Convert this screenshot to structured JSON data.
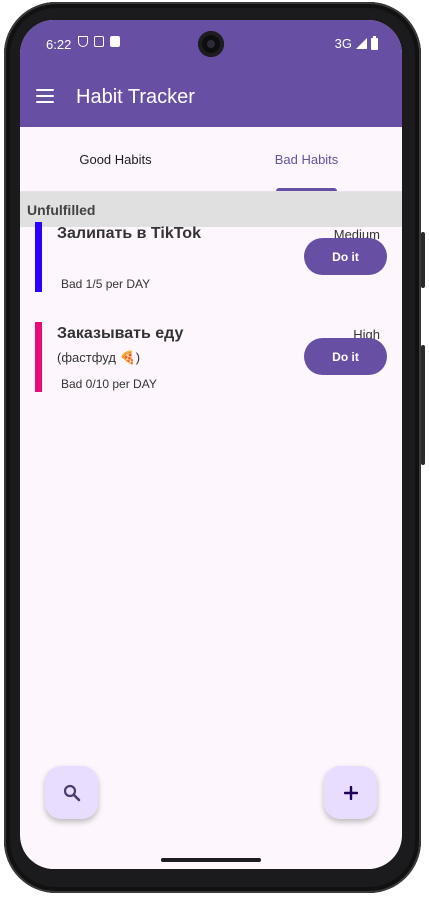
{
  "status_bar": {
    "time": "6:22",
    "network": "3G"
  },
  "app_bar": {
    "title": "Habit Tracker"
  },
  "tabs": [
    {
      "label": "Good Habits",
      "active": false
    },
    {
      "label": "Bad Habits",
      "active": true
    }
  ],
  "section": {
    "title": "Unfulfilled"
  },
  "habits": [
    {
      "name": "Залипать в TikTok",
      "description": "",
      "priority": "Medium",
      "frequency": "Bad 1/5 per DAY",
      "color": "#2b00ff",
      "button_label": "Do it"
    },
    {
      "name": "Заказывать еду",
      "description": "(фастфуд 🍕)",
      "priority": "High",
      "frequency": "Bad 0/10 per DAY",
      "color": "#ea0a73",
      "button_label": "Do it"
    }
  ],
  "fabs": {
    "search_icon": "search-icon",
    "add_icon": "add-icon"
  },
  "colors": {
    "primary": "#6750a4",
    "fab_bg": "#e9ddff",
    "background": "#fdf7fd",
    "section_bg": "#e0e0e0"
  }
}
